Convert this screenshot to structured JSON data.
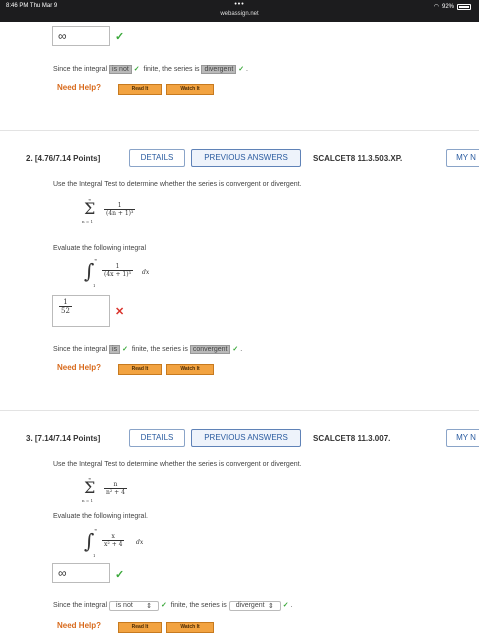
{
  "status_bar": {
    "time": "8:46 PM  Thu Mar 9",
    "dots": "•••",
    "url": "webassign.net",
    "battery": "92%"
  },
  "q1_tail": {
    "answer": "∞",
    "since_prefix": "Since the integral",
    "since_sel1": "is not",
    "since_mid": "finite, the series is",
    "since_sel2": "divergent",
    "need_help": "Need Help?",
    "read_it": "Read It",
    "watch_it": "Watch It"
  },
  "q2": {
    "header": "2.  [4.76/7.14 Points]",
    "details": "DETAILS",
    "previous": "PREVIOUS ANSWERS",
    "code": "SCALCET8 11.3.503.XP.",
    "my_notes": "MY N",
    "instruction": "Use the Integral Test to determine whether the series is convergent or divergent.",
    "series_num": "1",
    "series_den": "(4n + 1)³",
    "series_top": "∞",
    "series_bottom": "n = 1",
    "evaluate": "Evaluate the following integral",
    "integral_num": "1",
    "integral_den": "(4x + 1)³",
    "integral_dx": "dx",
    "integral_upper": "∞",
    "integral_lower": "1",
    "answer_num": "1",
    "answer_den": "52",
    "since_prefix": "Since the integral",
    "since_sel1": "is",
    "since_mid": "finite, the series is",
    "since_sel2": "convergent",
    "need_help": "Need Help?",
    "read_it": "Read It",
    "watch_it": "Watch It"
  },
  "q3": {
    "header": "3.  [7.14/7.14 Points]",
    "details": "DETAILS",
    "previous": "PREVIOUS ANSWERS",
    "code": "SCALCET8 11.3.007.",
    "my_notes": "MY N",
    "instruction": "Use the Integral Test to determine whether the series is convergent or divergent.",
    "series_num": "n",
    "series_den": "n² + 4",
    "series_top": "∞",
    "series_bottom": "n = 1",
    "evaluate": "Evaluate the following integral.",
    "integral_num": "x",
    "integral_den": "x² + 4",
    "integral_dx": "dx",
    "integral_upper": "∞",
    "integral_lower": "1",
    "answer": "∞",
    "since_prefix": "Since the integral",
    "since_sel1": "is not",
    "since_mid": "finite, the series is",
    "since_sel2": "divergent",
    "need_help": "Need Help?",
    "read_it": "Read It",
    "watch_it": "Watch It"
  }
}
